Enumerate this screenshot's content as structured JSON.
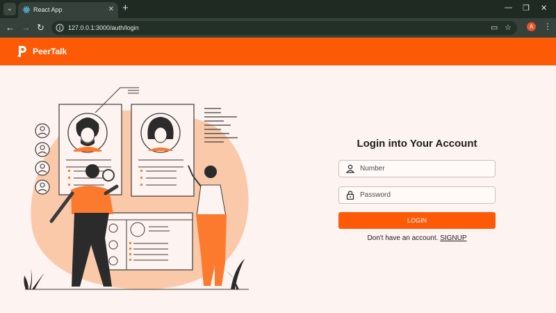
{
  "browser": {
    "tab_title": "React App",
    "url": "127.0.0.1:3000/auth/login",
    "profile_initial": "A",
    "icons": [
      "tab-search-icon",
      "react-icon",
      "close-icon",
      "plus-icon",
      "minimize-icon",
      "restore-icon",
      "back-icon",
      "forward-icon",
      "reload-icon",
      "site-info-icon",
      "cast-icon",
      "star-icon",
      "kebab-menu-icon"
    ]
  },
  "app": {
    "brand": "PeerTalk",
    "brand_color": "#fc5a06"
  },
  "login": {
    "title": "Login into Your Account",
    "number_placeholder": "Number",
    "password_placeholder": "Password",
    "button_label": "LOGIN",
    "signup_prompt": "Don't have an account.",
    "signup_link": "SIGNUP"
  }
}
